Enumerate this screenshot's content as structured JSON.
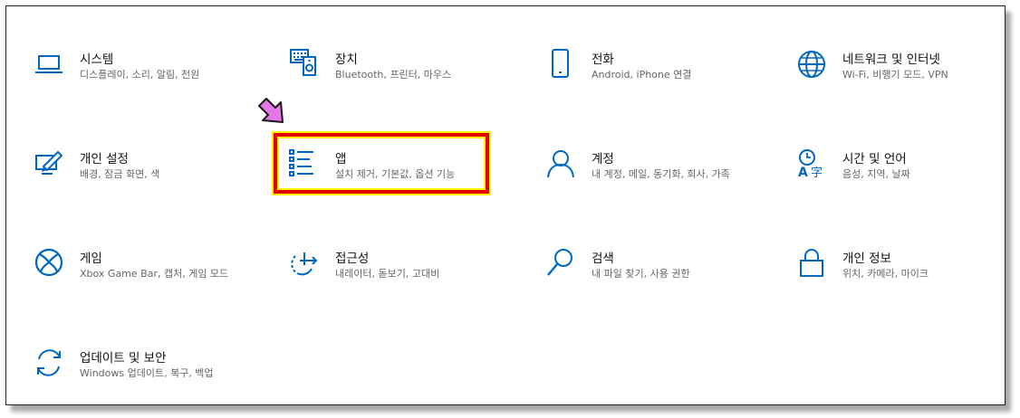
{
  "colors": {
    "accent": "#0067c0",
    "highlight_border": "#e00000",
    "highlight_glow": "#fff200",
    "pointer_fill": "#e377e8"
  },
  "tiles": [
    {
      "title": "시스템",
      "desc": "디스플레이, 소리, 알림, 전원",
      "icon": "laptop-icon"
    },
    {
      "title": "장치",
      "desc": "Bluetooth, 프린터, 마우스",
      "icon": "keyboard-speaker-icon"
    },
    {
      "title": "전화",
      "desc": "Android, iPhone 연결",
      "icon": "phone-icon"
    },
    {
      "title": "네트워크 및 인터넷",
      "desc": "Wi-Fi, 비행기 모드, VPN",
      "icon": "globe-icon"
    },
    {
      "title": "개인 설정",
      "desc": "배경, 잠금 화면, 색",
      "icon": "personalization-pen-icon"
    },
    {
      "title": "앱",
      "desc": "설치 제거, 기본값, 옵션 기능",
      "icon": "apps-list-icon"
    },
    {
      "title": "계정",
      "desc": "내 계정, 메일, 동기화, 회사, 가족",
      "icon": "person-icon"
    },
    {
      "title": "시간 및 언어",
      "desc": "음성, 지역, 날짜",
      "icon": "time-language-icon"
    },
    {
      "title": "게임",
      "desc": "Xbox Game Bar, 캡처, 게임 모드",
      "icon": "xbox-icon"
    },
    {
      "title": "접근성",
      "desc": "내레이터, 돋보기, 고대비",
      "icon": "accessibility-icon"
    },
    {
      "title": "검색",
      "desc": "내 파일 찾기, 사용 권한",
      "icon": "search-icon"
    },
    {
      "title": "개인 정보",
      "desc": "위치, 카메라, 마이크",
      "icon": "lock-icon"
    },
    {
      "title": "업데이트 및 보안",
      "desc": "Windows 업데이트, 복구, 백업",
      "icon": "sync-icon"
    }
  ]
}
